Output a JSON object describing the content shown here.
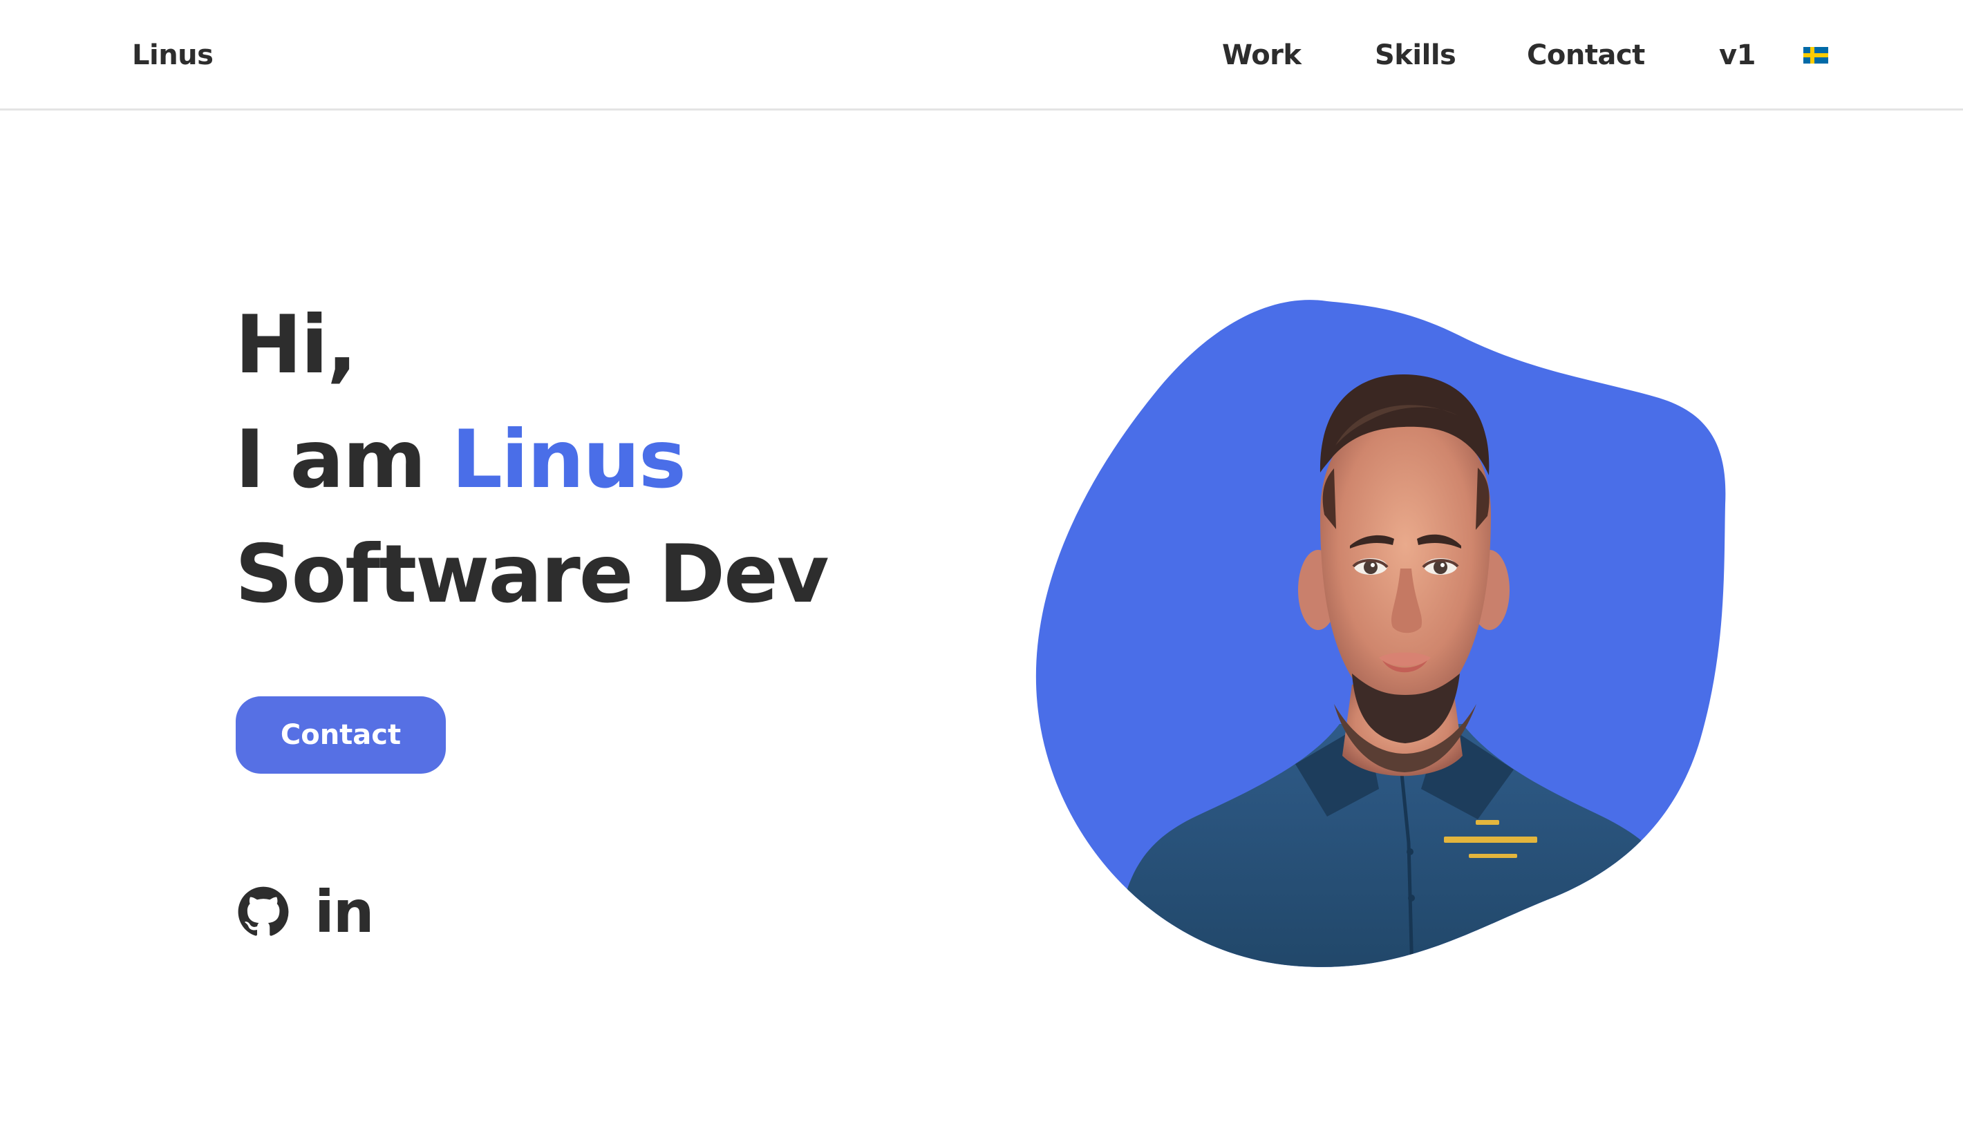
{
  "header": {
    "logo": "Linus",
    "nav": {
      "work": "Work",
      "skills": "Skills",
      "contact": "Contact",
      "version": "v1"
    },
    "language_flag_icon": "swedish-flag-icon"
  },
  "hero": {
    "greeting": "Hi,",
    "intro": "I am ",
    "name": "Linus",
    "role": "Software Dev",
    "cta_label": "Contact",
    "social": {
      "github_icon": "github-icon",
      "linkedin_label": "in"
    }
  },
  "portrait": {
    "image": "profile-photo"
  },
  "colors": {
    "accent": "#4a6ee8",
    "button": "#5670e4",
    "blob": "#4a6ee8",
    "text": "#2d2d2d"
  }
}
